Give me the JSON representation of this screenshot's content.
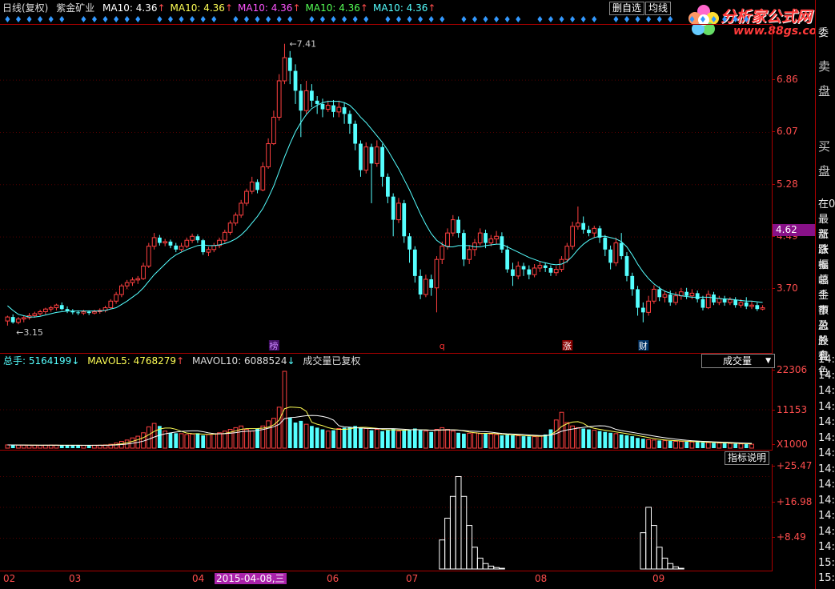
{
  "header": {
    "period": "日线(复权)",
    "stock_name": "紫金矿业",
    "ma_items": [
      {
        "label": "MA10: 4.36",
        "color": "#ffffff",
        "arrow": "↑"
      },
      {
        "label": "MA10: 4.36",
        "color": "#ffff55",
        "arrow": "↑"
      },
      {
        "label": "MA10: 4.36",
        "color": "#ff55ff",
        "arrow": "↑"
      },
      {
        "label": "MA10: 4.36",
        "color": "#55ff55",
        "arrow": "↑"
      },
      {
        "label": "MA10: 4.36",
        "color": "#55ffff",
        "arrow": "↑"
      }
    ],
    "btn_delete": "删自选",
    "btn_ma": "均线",
    "logo_text": "分析家公式网",
    "logo_url": "www.88gs.com"
  },
  "main_axis": {
    "ticks": [
      "6.86",
      "6.07",
      "5.28",
      "4.49",
      "3.70"
    ],
    "current_price": "4.62"
  },
  "main_annotations": {
    "high": "7.41",
    "low": "3.15"
  },
  "markers": [
    {
      "label": "榜",
      "color": "#c8f",
      "bg": "#416"
    },
    {
      "label": "q",
      "color": "#f33",
      "bg": "transparent"
    },
    {
      "label": "涨",
      "color": "#fff",
      "bg": "#800"
    },
    {
      "label": "财",
      "color": "#fff",
      "bg": "#036"
    }
  ],
  "volume_header": {
    "total": "总手: 5164199",
    "total_arrow": "↓",
    "mavol5": "MAVOL5: 4768279",
    "mavol5_arrow": "↑",
    "mavol10": "MAVOL10: 6088524",
    "mavol10_arrow": "↓",
    "note": "成交量已复权",
    "selector": "成交量"
  },
  "volume_axis": {
    "ticks": [
      "22306",
      "11153"
    ],
    "unit": "X1000"
  },
  "indicator": {
    "help_button": "指标说明",
    "ticks": [
      "+25.47",
      "+16.98",
      "+8.49"
    ]
  },
  "x_axis": {
    "labels": [
      "02",
      "03",
      "04",
      "05",
      "06",
      "07",
      "08",
      "09"
    ],
    "highlight": "2015-04-08,三"
  },
  "right_panel": {
    "labels_large": [
      "卖",
      "盘",
      "买",
      "盘"
    ],
    "labels_small": [
      "在0",
      "最新",
      "涨跌",
      "涨幅",
      "振幅",
      "总手",
      "金额",
      "市盈",
      "总股",
      "外盘",
      "有色"
    ],
    "times": [
      "14:",
      "14:",
      "14:",
      "14:",
      "14:",
      "14:",
      "14:",
      "14:",
      "14:",
      "14:",
      "14:",
      "14:",
      "14:",
      "15:",
      "15:"
    ],
    "top_label": "委"
  },
  "chart_data": {
    "type": "candlestick",
    "price_range": [
      3.1,
      7.6
    ],
    "candles": [
      [
        3.22,
        3.28,
        3.15,
        3.3
      ],
      [
        3.28,
        3.2,
        3.18,
        3.32
      ],
      [
        3.2,
        3.25,
        3.17,
        3.28
      ],
      [
        3.25,
        3.27,
        3.2,
        3.3
      ],
      [
        3.27,
        3.3,
        3.24,
        3.34
      ],
      [
        3.3,
        3.33,
        3.27,
        3.36
      ],
      [
        3.33,
        3.36,
        3.3,
        3.39
      ],
      [
        3.36,
        3.4,
        3.32,
        3.42
      ],
      [
        3.4,
        3.42,
        3.36,
        3.45
      ],
      [
        3.42,
        3.46,
        3.38,
        3.48
      ],
      [
        3.46,
        3.4,
        3.38,
        3.5
      ],
      [
        3.4,
        3.37,
        3.34,
        3.44
      ],
      [
        3.37,
        3.35,
        3.32,
        3.4
      ],
      [
        3.35,
        3.34,
        3.31,
        3.38
      ],
      [
        3.34,
        3.36,
        3.31,
        3.39
      ],
      [
        3.36,
        3.34,
        3.31,
        3.38
      ],
      [
        3.34,
        3.36,
        3.32,
        3.39
      ],
      [
        3.36,
        3.38,
        3.33,
        3.41
      ],
      [
        3.38,
        3.42,
        3.35,
        3.45
      ],
      [
        3.42,
        3.52,
        3.4,
        3.55
      ],
      [
        3.52,
        3.62,
        3.48,
        3.66
      ],
      [
        3.62,
        3.75,
        3.58,
        3.78
      ],
      [
        3.75,
        3.8,
        3.7,
        3.84
      ],
      [
        3.8,
        3.84,
        3.75,
        3.88
      ],
      [
        3.84,
        3.86,
        3.78,
        3.9
      ],
      [
        3.86,
        4.05,
        3.84,
        4.1
      ],
      [
        4.05,
        4.35,
        4.02,
        4.4
      ],
      [
        4.35,
        4.48,
        4.3,
        4.55
      ],
      [
        4.48,
        4.4,
        4.36,
        4.52
      ],
      [
        4.4,
        4.42,
        4.35,
        4.46
      ],
      [
        4.42,
        4.36,
        4.32,
        4.45
      ],
      [
        4.36,
        4.3,
        4.26,
        4.4
      ],
      [
        4.3,
        4.35,
        4.27,
        4.4
      ],
      [
        4.35,
        4.44,
        4.32,
        4.48
      ],
      [
        4.44,
        4.5,
        4.4,
        4.54
      ],
      [
        4.5,
        4.44,
        4.4,
        4.53
      ],
      [
        4.44,
        4.26,
        4.22,
        4.46
      ],
      [
        4.26,
        4.3,
        4.2,
        4.34
      ],
      [
        4.3,
        4.36,
        4.26,
        4.4
      ],
      [
        4.36,
        4.44,
        4.32,
        4.48
      ],
      [
        4.44,
        4.56,
        4.4,
        4.6
      ],
      [
        4.56,
        4.7,
        4.52,
        4.74
      ],
      [
        4.7,
        4.82,
        4.66,
        4.86
      ],
      [
        4.82,
        5.0,
        4.78,
        5.05
      ],
      [
        5.0,
        5.18,
        4.96,
        5.22
      ],
      [
        5.18,
        5.32,
        5.14,
        5.4
      ],
      [
        5.32,
        5.2,
        5.15,
        5.36
      ],
      [
        5.2,
        5.55,
        5.18,
        5.62
      ],
      [
        5.55,
        5.9,
        5.52,
        5.98
      ],
      [
        5.9,
        6.3,
        5.88,
        6.4
      ],
      [
        6.3,
        6.85,
        6.25,
        6.95
      ],
      [
        6.85,
        7.2,
        6.8,
        7.41
      ],
      [
        7.2,
        7.0,
        6.8,
        7.3
      ],
      [
        7.0,
        6.7,
        6.5,
        7.1
      ],
      [
        6.7,
        6.4,
        6.0,
        6.8
      ],
      [
        6.4,
        6.7,
        6.35,
        6.85
      ],
      [
        6.7,
        6.55,
        6.45,
        6.8
      ],
      [
        6.55,
        6.5,
        6.35,
        6.62
      ],
      [
        6.5,
        6.42,
        6.3,
        6.58
      ],
      [
        6.42,
        6.48,
        6.38,
        6.55
      ],
      [
        6.48,
        6.38,
        6.3,
        6.56
      ],
      [
        6.38,
        6.45,
        6.3,
        6.55
      ],
      [
        6.45,
        6.35,
        6.2,
        6.52
      ],
      [
        6.35,
        6.2,
        6.05,
        6.4
      ],
      [
        6.2,
        5.9,
        5.8,
        6.25
      ],
      [
        5.9,
        5.5,
        5.4,
        5.95
      ],
      [
        5.5,
        5.85,
        5.45,
        5.92
      ],
      [
        5.85,
        5.6,
        5.0,
        5.9
      ],
      [
        5.6,
        5.85,
        5.55,
        5.95
      ],
      [
        5.85,
        5.4,
        5.25,
        5.9
      ],
      [
        5.4,
        5.1,
        5.0,
        5.45
      ],
      [
        5.1,
        4.75,
        4.5,
        5.15
      ],
      [
        4.75,
        5.0,
        4.7,
        5.08
      ],
      [
        5.0,
        4.5,
        4.4,
        5.05
      ],
      [
        4.5,
        4.3,
        4.1,
        4.55
      ],
      [
        4.3,
        3.9,
        3.8,
        4.35
      ],
      [
        3.9,
        3.62,
        3.55,
        4.0
      ],
      [
        3.62,
        3.85,
        3.58,
        3.92
      ],
      [
        3.85,
        3.72,
        3.6,
        3.92
      ],
      [
        3.72,
        4.15,
        3.35,
        4.2
      ],
      [
        4.15,
        4.35,
        4.08,
        4.42
      ],
      [
        4.35,
        4.55,
        4.3,
        4.62
      ],
      [
        4.55,
        4.75,
        4.5,
        4.82
      ],
      [
        4.75,
        4.55,
        4.48,
        4.8
      ],
      [
        4.55,
        4.15,
        4.05,
        4.6
      ],
      [
        4.15,
        4.3,
        4.08,
        4.36
      ],
      [
        4.3,
        4.4,
        4.2,
        4.46
      ],
      [
        4.4,
        4.55,
        4.36,
        4.62
      ],
      [
        4.55,
        4.4,
        4.32,
        4.6
      ],
      [
        4.4,
        4.46,
        4.35,
        4.52
      ],
      [
        4.46,
        4.5,
        4.38,
        4.58
      ],
      [
        4.5,
        4.3,
        4.25,
        4.56
      ],
      [
        4.3,
        4.0,
        3.95,
        4.36
      ],
      [
        4.0,
        3.9,
        3.75,
        4.1
      ],
      [
        3.9,
        4.05,
        3.85,
        4.12
      ],
      [
        4.05,
        4.0,
        3.9,
        4.1
      ],
      [
        4.0,
        3.92,
        3.85,
        4.06
      ],
      [
        3.92,
        4.02,
        3.88,
        4.08
      ],
      [
        4.02,
        4.06,
        3.96,
        4.12
      ],
      [
        4.06,
        4.02,
        3.96,
        4.1
      ],
      [
        4.02,
        3.95,
        3.9,
        4.06
      ],
      [
        3.95,
        4.0,
        3.9,
        4.05
      ],
      [
        4.0,
        4.15,
        3.96,
        4.2
      ],
      [
        4.15,
        4.35,
        4.1,
        4.4
      ],
      [
        4.35,
        4.65,
        4.3,
        4.72
      ],
      [
        4.65,
        4.7,
        4.6,
        4.95
      ],
      [
        4.7,
        4.6,
        4.54,
        4.8
      ],
      [
        4.6,
        4.55,
        4.5,
        4.66
      ],
      [
        4.55,
        4.62,
        4.48,
        4.66
      ],
      [
        4.62,
        4.48,
        4.4,
        4.66
      ],
      [
        4.48,
        4.3,
        4.2,
        4.52
      ],
      [
        4.3,
        4.1,
        4.0,
        4.36
      ],
      [
        4.1,
        4.4,
        4.05,
        4.48
      ],
      [
        4.4,
        4.2,
        4.15,
        4.55
      ],
      [
        4.2,
        3.9,
        3.82,
        4.26
      ],
      [
        3.9,
        3.7,
        3.6,
        3.95
      ],
      [
        3.7,
        3.42,
        3.3,
        3.75
      ],
      [
        3.42,
        3.35,
        3.2,
        3.5
      ],
      [
        3.35,
        3.52,
        3.3,
        3.6
      ],
      [
        3.52,
        3.7,
        3.48,
        3.76
      ],
      [
        3.7,
        3.58,
        3.52,
        3.74
      ],
      [
        3.58,
        3.62,
        3.5,
        3.68
      ],
      [
        3.62,
        3.5,
        3.45,
        3.68
      ],
      [
        3.5,
        3.6,
        3.46,
        3.66
      ],
      [
        3.6,
        3.66,
        3.54,
        3.72
      ],
      [
        3.66,
        3.6,
        3.55,
        3.72
      ],
      [
        3.6,
        3.64,
        3.55,
        3.7
      ],
      [
        3.64,
        3.55,
        3.5,
        3.68
      ],
      [
        3.55,
        3.42,
        3.38,
        3.6
      ],
      [
        3.42,
        3.62,
        3.4,
        3.68
      ],
      [
        3.62,
        3.5,
        3.46,
        3.66
      ],
      [
        3.5,
        3.56,
        3.46,
        3.6
      ],
      [
        3.56,
        3.5,
        3.45,
        3.6
      ],
      [
        3.5,
        3.54,
        3.46,
        3.58
      ],
      [
        3.54,
        3.46,
        3.42,
        3.58
      ],
      [
        3.46,
        3.5,
        3.42,
        3.55
      ],
      [
        3.5,
        3.44,
        3.4,
        3.58
      ],
      [
        3.44,
        3.46,
        3.4,
        3.52
      ],
      [
        3.46,
        3.4,
        3.37,
        3.5
      ],
      [
        3.4,
        3.42,
        3.38,
        3.46
      ]
    ],
    "ma_line": [
      3.45,
      3.38,
      3.32,
      3.3,
      3.28,
      3.28,
      3.29,
      3.31,
      3.33,
      3.35,
      3.36,
      3.37,
      3.37,
      3.37,
      3.37,
      3.37,
      3.37,
      3.37,
      3.38,
      3.4,
      3.42,
      3.47,
      3.52,
      3.58,
      3.64,
      3.72,
      3.82,
      3.92,
      4.0,
      4.08,
      4.16,
      4.22,
      4.26,
      4.3,
      4.33,
      4.36,
      4.37,
      4.36,
      4.36,
      4.37,
      4.39,
      4.42,
      4.46,
      4.52,
      4.6,
      4.7,
      4.8,
      4.92,
      5.08,
      5.26,
      5.48,
      5.7,
      5.9,
      6.08,
      6.22,
      6.34,
      6.43,
      6.48,
      6.52,
      6.54,
      6.54,
      6.54,
      6.52,
      6.48,
      6.4,
      6.3,
      6.22,
      6.12,
      6.02,
      5.92,
      5.8,
      5.66,
      5.52,
      5.36,
      5.2,
      5.02,
      4.84,
      4.68,
      4.54,
      4.44,
      4.38,
      4.34,
      4.34,
      4.36,
      4.36,
      4.36,
      4.34,
      4.34,
      4.36,
      4.37,
      4.38,
      4.38,
      4.34,
      4.3,
      4.26,
      4.22,
      4.18,
      4.15,
      4.12,
      4.1,
      4.08,
      4.07,
      4.08,
      4.12,
      4.2,
      4.3,
      4.38,
      4.44,
      4.48,
      4.5,
      4.5,
      4.48,
      4.46,
      4.42,
      4.34,
      4.22,
      4.08,
      3.96,
      3.86,
      3.78,
      3.72,
      3.67,
      3.64,
      3.62,
      3.6,
      3.59,
      3.58,
      3.58,
      3.58,
      3.58,
      3.57,
      3.56,
      3.55,
      3.55,
      3.54,
      3.53,
      3.52,
      3.52,
      3.51,
      3.5
    ],
    "volume": [
      38,
      36,
      35,
      34,
      35,
      33,
      32,
      34,
      36,
      35,
      34,
      33,
      32,
      33,
      32,
      33,
      34,
      35,
      38,
      45,
      60,
      80,
      95,
      120,
      140,
      180,
      250,
      290,
      260,
      200,
      180,
      175,
      170,
      160,
      165,
      175,
      150,
      160,
      170,
      180,
      200,
      220,
      240,
      260,
      220,
      200,
      230,
      260,
      320,
      350,
      480,
      900,
      360,
      300,
      320,
      280,
      260,
      240,
      220,
      200,
      210,
      230,
      240,
      250,
      260,
      240,
      230,
      210,
      220,
      200,
      210,
      230,
      200,
      210,
      220,
      230,
      210,
      200,
      190,
      220,
      240,
      220,
      200,
      180,
      170,
      175,
      180,
      170,
      175,
      165,
      160,
      150,
      155,
      150,
      145,
      140,
      138,
      135,
      140,
      160,
      220,
      330,
      420,
      300,
      260,
      240,
      230,
      220,
      210,
      200,
      190,
      180,
      170,
      160,
      150,
      140,
      120,
      110,
      100,
      95,
      90,
      88,
      85,
      80,
      78,
      75,
      72,
      70,
      68,
      65,
      62,
      60,
      58,
      55,
      52,
      50,
      48,
      46
    ],
    "volume_max": 900,
    "indicator_range": [
      0,
      28
    ],
    "indicator_a": {
      "start": 80,
      "values": [
        8,
        14,
        20,
        25.47,
        20,
        12,
        6,
        3,
        1.5,
        0.8,
        0.4,
        0.2
      ]
    },
    "indicator_b": {
      "start": 117,
      "values": [
        10,
        17,
        12,
        6,
        3,
        1.5,
        0.6,
        0.2
      ]
    }
  }
}
